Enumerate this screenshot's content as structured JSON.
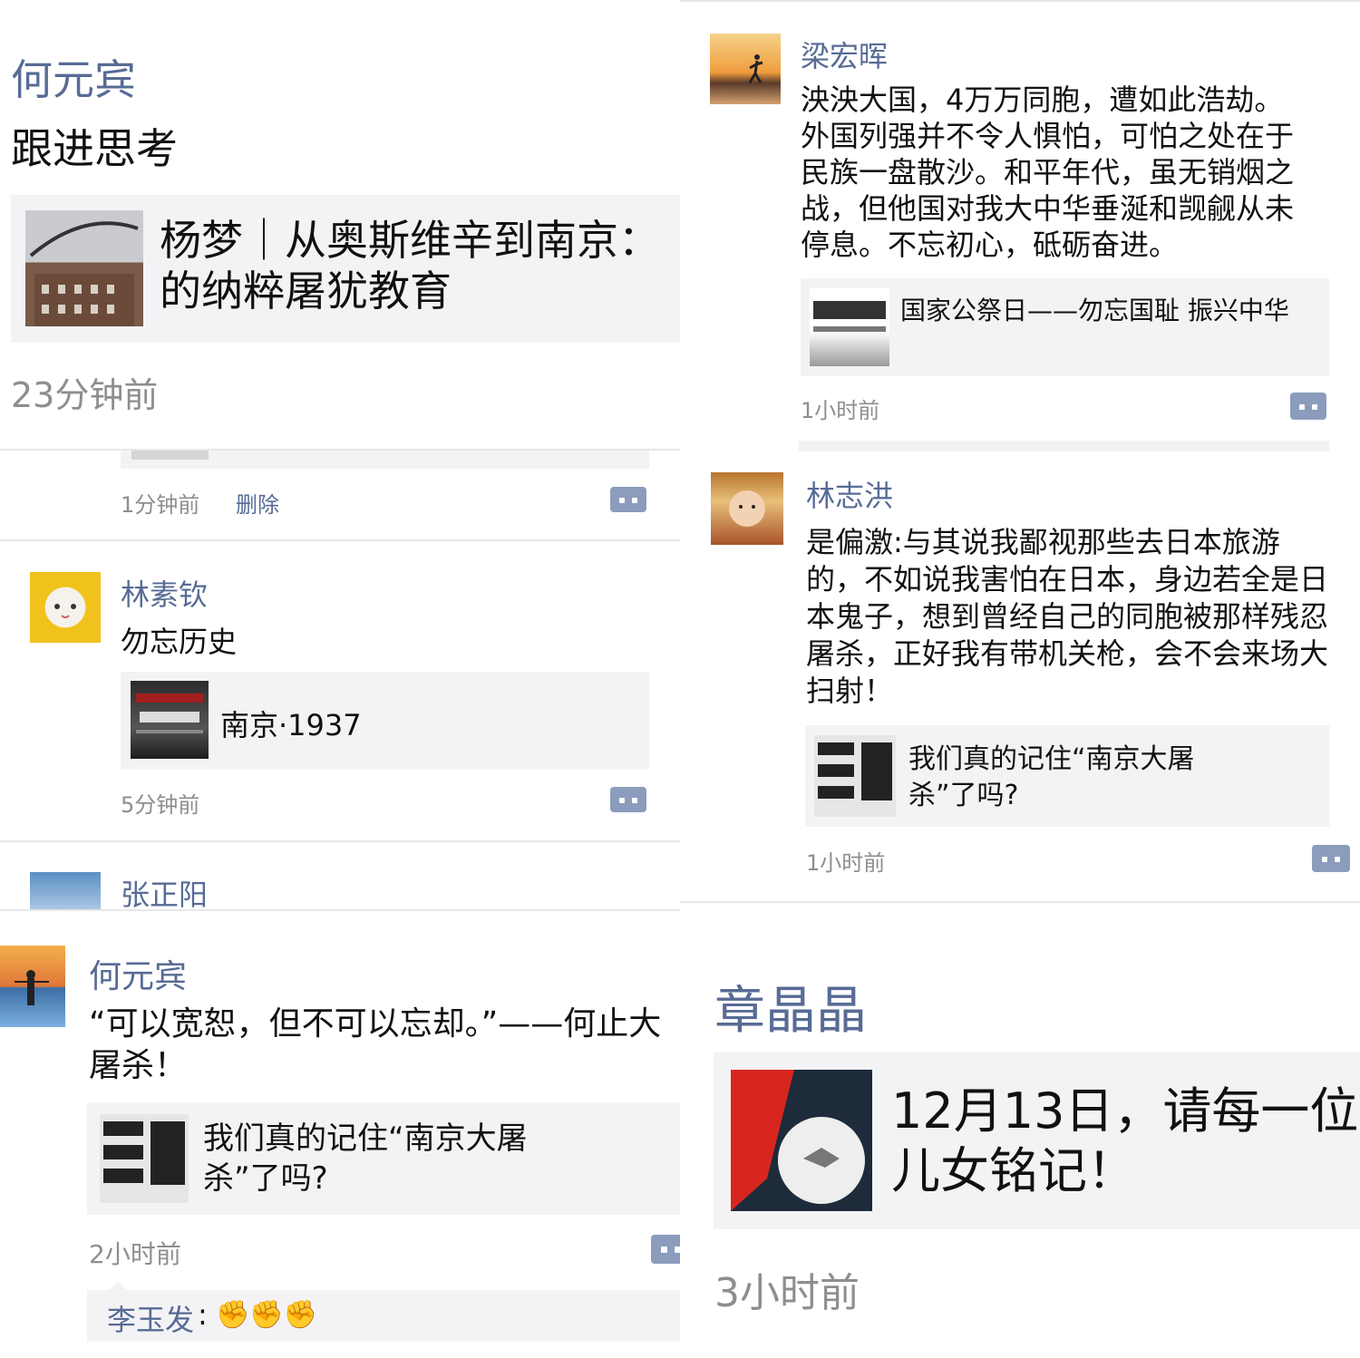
{
  "topLeft": {
    "author": "何元宾",
    "text": "跟进思考",
    "card_title": "杨梦｜从奥斯维辛到南京：的纳粹屠犹教育",
    "time": "23分钟前"
  },
  "leftMid": {
    "row1": {
      "time": "1分钟前",
      "delete": "删除"
    },
    "post1": {
      "author": "林素钦",
      "text": "勿忘历史",
      "card_title": "南京·1937",
      "time": "5分钟前"
    },
    "post2": {
      "author": "张正阳"
    }
  },
  "bottomLeft": {
    "author": "何元宾",
    "text": "“可以宽恕，但不可以忘却。”——何止大屠杀！",
    "card_title": "我们真的记住“南京大屠杀”了吗?",
    "time": "2小时前",
    "comment_author": "李玉发",
    "comment_sep": ":",
    "comment_emoji": "✊✊✊"
  },
  "topRight": {
    "post1": {
      "author": "梁宏晖",
      "text": "泱泱大国，4万万同胞，遭如此浩劫。外国列强并不令人惧怕，可怕之处在于民族一盘散沙。和平年代，虽无销烟之战，但他国对我大中华垂涎和觊觎从未停息。不忘初心，砥砺奋进。",
      "card_title": "国家公祭日——勿忘国耻 振兴中华",
      "time": "1小时前"
    },
    "post2": {
      "author": "林志洪",
      "text": "是偏激:与其说我鄙视那些去日本旅游的，不如说我害怕在日本，身边若全是日本鬼子，想到曾经自己的同胞被那样残忍屠杀，正好我有带机关枪，会不会来场大扫射！",
      "card_title": "我们真的记住“南京大屠杀”了吗?",
      "time": "1小时前"
    }
  },
  "bottomRight": {
    "author": "章晶晶",
    "card_title": "12月13日，请每一位儿女铭记！",
    "time": "3小时前"
  },
  "colors": {
    "link": "#576b95",
    "card_bg": "#f3f3f5",
    "time": "#8e8e8e",
    "comment_btn": "#8c9cbd"
  }
}
